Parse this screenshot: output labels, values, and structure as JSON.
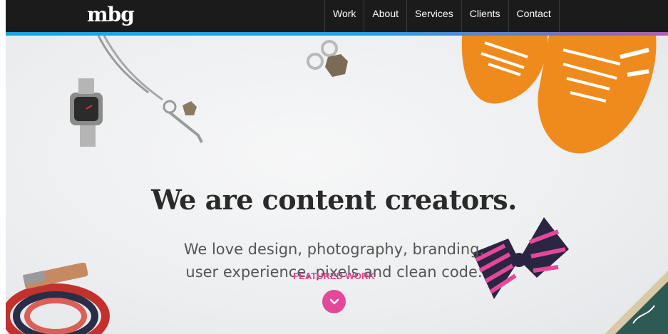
{
  "header": {
    "logo": "mbg",
    "nav": [
      {
        "label": "Work"
      },
      {
        "label": "About"
      },
      {
        "label": "Services"
      },
      {
        "label": "Clients"
      },
      {
        "label": "Contact"
      }
    ]
  },
  "hero": {
    "headline": "We are content creators.",
    "subline_1": "We love design, photography, branding,",
    "subline_2": "user experience, pixels and clean code.",
    "featured_label": "FEATURED WORK",
    "featured_icon": "chevron-down-icon"
  },
  "colors": {
    "topbar": "#1b1b1b",
    "accent_pink": "#e5489a",
    "strip_blue": "#1aa5e0",
    "strip_purple": "#b05fb0"
  }
}
